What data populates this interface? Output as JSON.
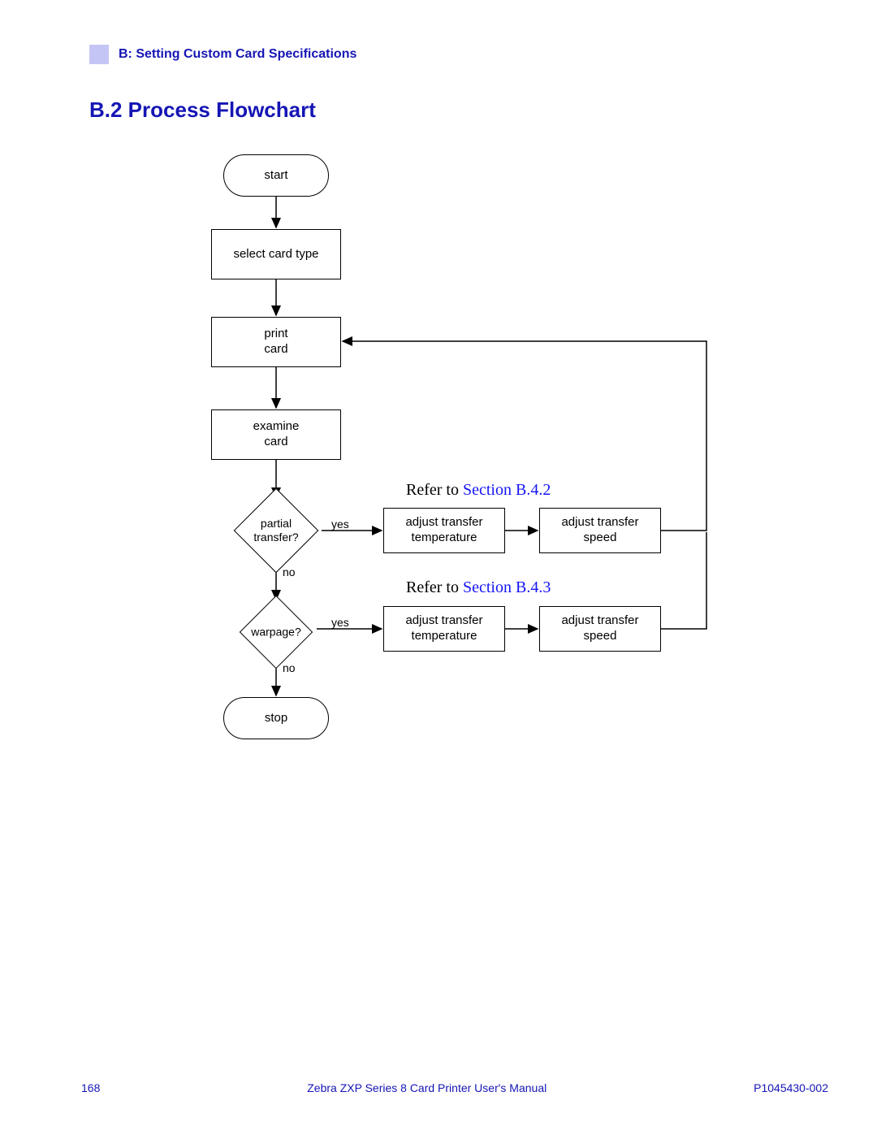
{
  "header": {
    "chapter": "B: Setting Custom Card Specifications"
  },
  "section": {
    "title": "B.2  Process Flowchart"
  },
  "nodes": {
    "start": "start",
    "select_card": "select card type",
    "print_card_l1": "print",
    "print_card_l2": "card",
    "examine_l1": "examine",
    "examine_l2": "card",
    "partial_l1": "partial",
    "partial_l2": "transfer?",
    "warpage": "warpage?",
    "adj_temp_l1": "adjust transfer",
    "adj_temp_l2": "temperature",
    "adj_speed_l1": "adjust transfer",
    "adj_speed_l2": "speed",
    "stop": "stop"
  },
  "labels": {
    "yes": "yes",
    "no": "no"
  },
  "refs": {
    "r1_prefix": "Refer to ",
    "r1_link": "Section B.4.2",
    "r2_prefix": "Refer to ",
    "r2_link": "Section B.4.3"
  },
  "footer": {
    "page": "168",
    "manual": "Zebra ZXP Series 8 Card Printer User's Manual",
    "doc": "P1045430-002"
  },
  "chart_data": {
    "type": "flowchart",
    "title": "B.2 Process Flowchart",
    "nodes": [
      {
        "id": "start",
        "shape": "terminator",
        "label": "start"
      },
      {
        "id": "select",
        "shape": "process",
        "label": "select card type"
      },
      {
        "id": "print",
        "shape": "process",
        "label": "print card"
      },
      {
        "id": "examine",
        "shape": "process",
        "label": "examine card"
      },
      {
        "id": "partial",
        "shape": "decision",
        "label": "partial transfer?"
      },
      {
        "id": "adj_temp_1",
        "shape": "process",
        "label": "adjust transfer temperature"
      },
      {
        "id": "adj_speed_1",
        "shape": "process",
        "label": "adjust transfer speed"
      },
      {
        "id": "warpage",
        "shape": "decision",
        "label": "warpage?"
      },
      {
        "id": "adj_temp_2",
        "shape": "process",
        "label": "adjust transfer temperature"
      },
      {
        "id": "adj_speed_2",
        "shape": "process",
        "label": "adjust transfer speed"
      },
      {
        "id": "stop",
        "shape": "terminator",
        "label": "stop"
      }
    ],
    "edges": [
      {
        "from": "start",
        "to": "select"
      },
      {
        "from": "select",
        "to": "print"
      },
      {
        "from": "print",
        "to": "examine"
      },
      {
        "from": "examine",
        "to": "partial"
      },
      {
        "from": "partial",
        "to": "adj_temp_1",
        "label": "yes"
      },
      {
        "from": "adj_temp_1",
        "to": "adj_speed_1"
      },
      {
        "from": "adj_speed_1",
        "to": "print"
      },
      {
        "from": "partial",
        "to": "warpage",
        "label": "no"
      },
      {
        "from": "warpage",
        "to": "adj_temp_2",
        "label": "yes"
      },
      {
        "from": "adj_temp_2",
        "to": "adj_speed_2"
      },
      {
        "from": "adj_speed_2",
        "to": "print"
      },
      {
        "from": "warpage",
        "to": "stop",
        "label": "no"
      }
    ],
    "annotations": [
      {
        "near": "partial-yes-branch",
        "text": "Refer to Section B.4.2"
      },
      {
        "near": "warpage-yes-branch",
        "text": "Refer to Section B.4.3"
      }
    ]
  }
}
